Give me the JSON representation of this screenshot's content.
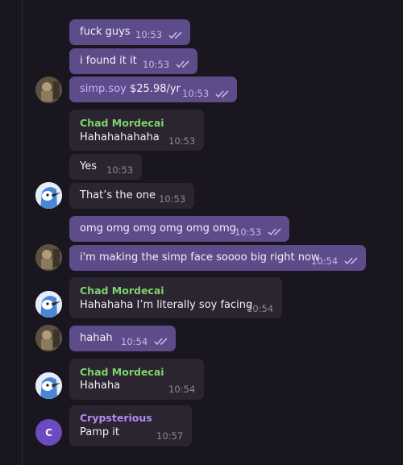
{
  "messages": {
    "m1": {
      "text": "fuck guys",
      "time": "10:53"
    },
    "m2": {
      "text": "i found it it",
      "time": "10:53"
    },
    "m3": {
      "link": "simp.soy",
      "text": "$25.98/yr",
      "time": "10:53"
    },
    "m4": {
      "sender": "Chad Mordecai",
      "text": "Hahahahahaha",
      "time": "10:53"
    },
    "m5": {
      "text": "Yes",
      "time": "10:53"
    },
    "m6": {
      "text": "That’s the one",
      "time": "10:53"
    },
    "m7": {
      "text": "omg omg omg omg omg omg",
      "time": "10:53"
    },
    "m8": {
      "text": "i'm making the simp face soooo big right now",
      "time": "10:54"
    },
    "m9": {
      "sender": "Chad Mordecai",
      "text": "Hahahaha I’m literally soy facing",
      "time": "10:54"
    },
    "m10": {
      "text": "hahah",
      "time": "10:54"
    },
    "m11": {
      "sender": "Chad Mordecai",
      "text": "Hahaha",
      "time": "10:54"
    },
    "m12": {
      "sender": "Crypsterious",
      "text": "Pamp it",
      "time": "10:57",
      "avatar_letter": "C"
    }
  },
  "colors": {
    "background": "#1a1620",
    "outgoing_bubble": "#5d4b8a",
    "incoming_bubble": "#2a2530",
    "sender_chad": "#7ed36b",
    "sender_crypsterious": "#b48cf0",
    "read_checks": "#c5b8e6"
  },
  "icons": {
    "read_receipt": "double-check-icon",
    "self_avatar": "user-photo-avatar",
    "chad_avatar": "blue-jay-avatar"
  }
}
